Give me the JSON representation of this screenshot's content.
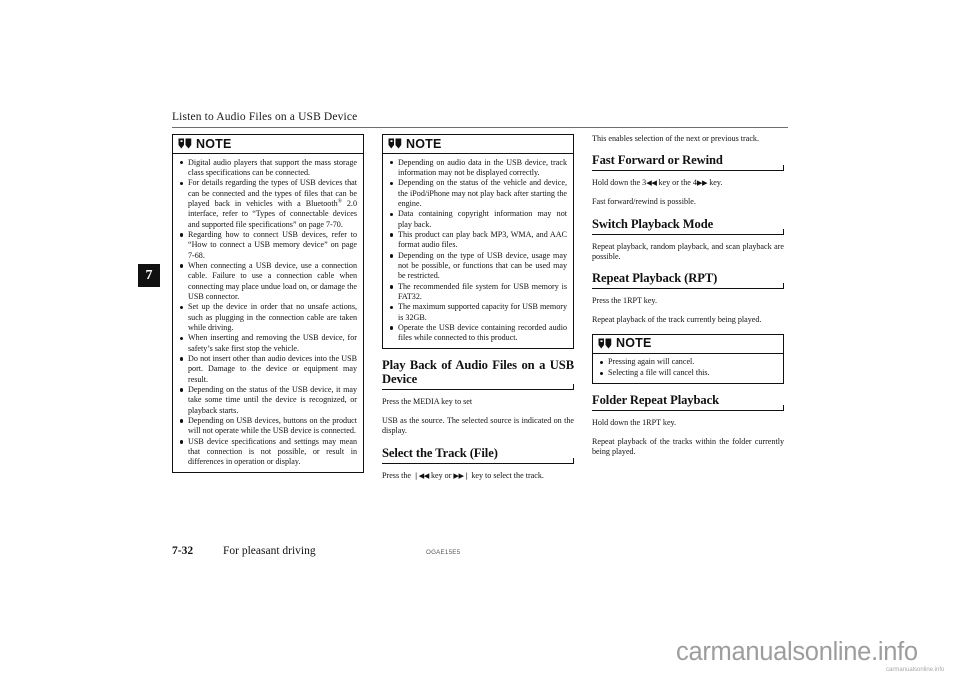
{
  "header": {
    "title": "Listen to Audio Files on a USB Device"
  },
  "chapter_tab": {
    "number": "7"
  },
  "note_label": "NOTE",
  "note_icon": "open-book-icon",
  "column1": {
    "note": {
      "title": "NOTE",
      "bullets": [
        "Digital audio players that support the mass storage class specifications can be connected.",
        "For details regarding the types of USB devices that can be connected and the types of files that can be played back in vehicles with a Bluetooth® 2.0 interface, refer to “Types of connectable devices and supported file specifications” on page 7-70.",
        "Regarding how to connect USB devices, refer to “How to connect a USB memory device” on page 7-68.",
        "When connecting a USB device, use a connection cable. Failure to use a connection cable when connecting may place undue load on, or damage the USB connector.",
        "Set up the device in order that no unsafe actions, such as plugging in the connection cable are taken while driving.",
        "When inserting and removing the USB device, for safety’s sake first stop the vehicle.",
        "Do not insert other than audio devices into the USB port. Damage to the device or equipment may result.",
        "Depending on the status of the USB device, it may take some time until the device is recognized, or playback starts.",
        "Depending on USB devices, buttons on the product will not operate while the USB device is connected.",
        "USB device specifications and settings may mean that connection is not possible, or result in differences in operation or display."
      ]
    }
  },
  "column2": {
    "note": {
      "title": "NOTE",
      "bullets": [
        "Depending on audio data in the USB device, track information may not be displayed correctly.",
        "Depending on the status of the vehicle and device, the iPod/iPhone may not play back after starting the engine.",
        "Data containing copyright information may not play back.",
        "This product can play back MP3, WMA, and AAC format audio files.",
        "Depending on the type of USB device, usage may not be possible, or functions that can be used may be restricted.",
        "The recommended file system for USB memory is FAT32.",
        "The maximum supported capacity for USB memory is 32GB.",
        "Operate the USB device containing recorded audio files while connected to this product."
      ]
    },
    "section_playback": {
      "heading": "Play Back of Audio Files on a USB Device",
      "para1": "Press the MEDIA key to set",
      "para2": "USB as the source. The selected source is indicated on the display."
    },
    "section_select_track": {
      "heading": "Select the Track (File)",
      "para_prefix": "Press the ",
      "key_prev": "❘◀◀",
      "para_mid": " key or ",
      "key_next": "▶▶❘",
      "para_suffix": " key to select the track."
    }
  },
  "column3": {
    "intro": "This enables selection of the next or previous track.",
    "section_ff": {
      "heading": "Fast Forward or Rewind",
      "para_prefix": "Hold down the 3",
      "key_rew": "◀◀",
      "para_mid": " key or the 4",
      "key_ff": "▶▶",
      "para_suffix": " key.",
      "para2": "Fast forward/rewind is possible."
    },
    "section_switch_mode": {
      "heading": "Switch Playback Mode",
      "para1": "Repeat playback, random playback, and scan playback are possible."
    },
    "section_repeat": {
      "heading": "Repeat Playback (RPT)",
      "para1": "Press the 1RPT key.",
      "para2": "Repeat playback of the track currently being played."
    },
    "note": {
      "title": "NOTE",
      "bullets": [
        "Pressing again will cancel.",
        "Selecting a file will cancel this."
      ]
    },
    "section_folder_repeat": {
      "heading": "Folder Repeat Playback",
      "para1": "Hold down the 1RPT key.",
      "para2": "Repeat playback of the tracks within the folder currently being played."
    }
  },
  "footer": {
    "page_number": "7-32",
    "section_name": "For pleasant driving",
    "doc_code": "OGAE15E5"
  },
  "watermark": {
    "main": "carmanualsonline.info",
    "small": "carmanualsonline.info"
  },
  "colors": {
    "ink": "#111111",
    "rule": "#6e6e6e",
    "watermark": "#9d9d9d"
  }
}
